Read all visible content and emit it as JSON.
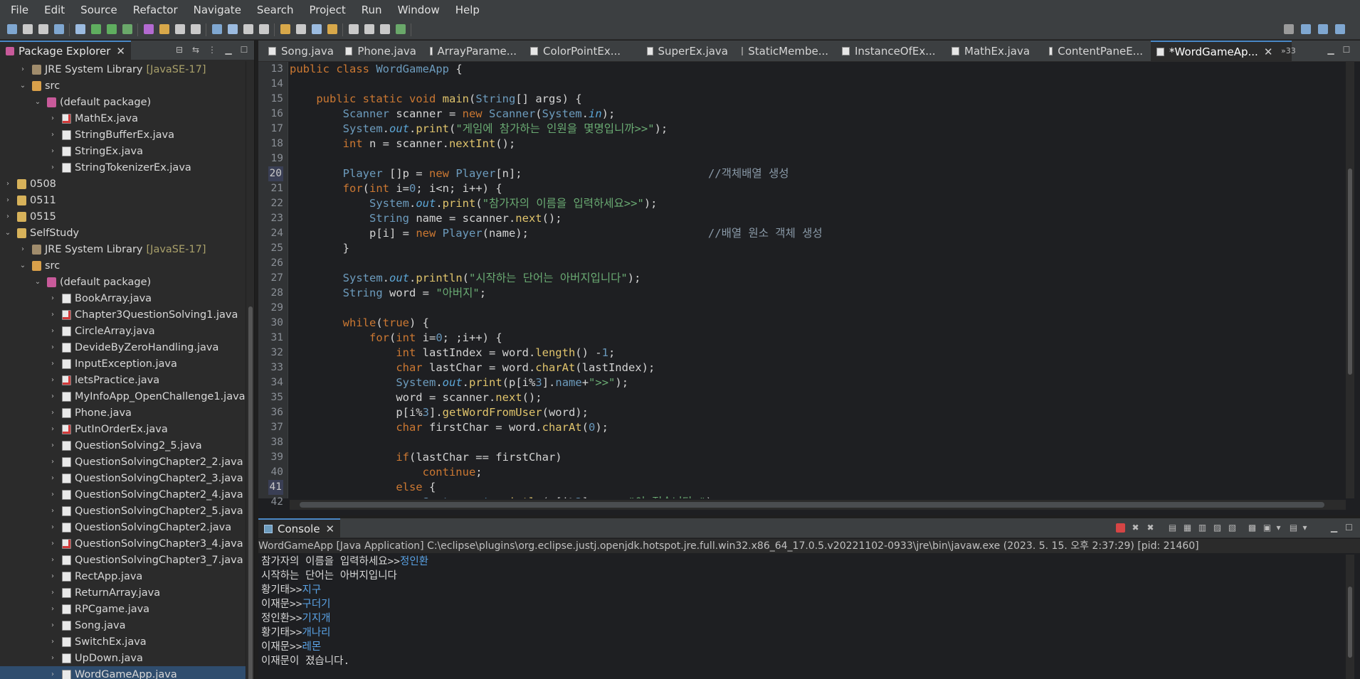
{
  "menu": [
    "File",
    "Edit",
    "Source",
    "Refactor",
    "Navigate",
    "Search",
    "Project",
    "Run",
    "Window",
    "Help"
  ],
  "package_explorer": {
    "title": "Package Explorer",
    "items": [
      {
        "label": "JRE System Library",
        "decoration": "[JavaSE-17]",
        "icon": "library-icon",
        "indent": 1,
        "arrow": "›"
      },
      {
        "label": "src",
        "icon": "source-folder-icon",
        "indent": 1,
        "arrow": "⌄"
      },
      {
        "label": "(default package)",
        "icon": "package-icon",
        "indent": 2,
        "arrow": "⌄"
      },
      {
        "label": "MathEx.java",
        "icon": "java-error-file-icon",
        "indent": 3,
        "arrow": "›"
      },
      {
        "label": "StringBufferEx.java",
        "icon": "java-file-icon",
        "indent": 3,
        "arrow": "›"
      },
      {
        "label": "StringEx.java",
        "icon": "java-file-icon",
        "indent": 3,
        "arrow": "›"
      },
      {
        "label": "StringTokenizerEx.java",
        "icon": "java-file-icon",
        "indent": 3,
        "arrow": "›"
      },
      {
        "label": "0508",
        "icon": "project-folder-icon",
        "indent": 0,
        "arrow": "›"
      },
      {
        "label": "0511",
        "icon": "project-folder-icon",
        "indent": 0,
        "arrow": "›"
      },
      {
        "label": "0515",
        "icon": "project-folder-icon",
        "indent": 0,
        "arrow": "›"
      },
      {
        "label": "SelfStudy",
        "icon": "project-folder-icon",
        "indent": 0,
        "arrow": "⌄"
      },
      {
        "label": "JRE System Library",
        "decoration": "[JavaSE-17]",
        "icon": "library-icon",
        "indent": 1,
        "arrow": "›"
      },
      {
        "label": "src",
        "icon": "source-folder-icon",
        "indent": 1,
        "arrow": "⌄"
      },
      {
        "label": "(default package)",
        "icon": "package-icon",
        "indent": 2,
        "arrow": "⌄"
      },
      {
        "label": "BookArray.java",
        "icon": "java-file-icon",
        "indent": 3,
        "arrow": "›"
      },
      {
        "label": "Chapter3QuestionSolving1.java",
        "icon": "java-error-file-icon",
        "indent": 3,
        "arrow": "›"
      },
      {
        "label": "CircleArray.java",
        "icon": "java-file-icon",
        "indent": 3,
        "arrow": "›"
      },
      {
        "label": "DevideByZeroHandling.java",
        "icon": "java-file-icon",
        "indent": 3,
        "arrow": "›"
      },
      {
        "label": "InputException.java",
        "icon": "java-file-icon",
        "indent": 3,
        "arrow": "›"
      },
      {
        "label": "letsPractice.java",
        "icon": "java-error-file-icon",
        "indent": 3,
        "arrow": "›"
      },
      {
        "label": "MyInfoApp_OpenChallenge1.java",
        "icon": "java-file-icon",
        "indent": 3,
        "arrow": "›"
      },
      {
        "label": "Phone.java",
        "icon": "java-file-icon",
        "indent": 3,
        "arrow": "›"
      },
      {
        "label": "PutInOrderEx.java",
        "icon": "java-error-file-icon",
        "indent": 3,
        "arrow": "›"
      },
      {
        "label": "QuestionSolving2_5.java",
        "icon": "java-file-icon",
        "indent": 3,
        "arrow": "›"
      },
      {
        "label": "QuestionSolvingChapter2_2.java",
        "icon": "java-file-icon",
        "indent": 3,
        "arrow": "›"
      },
      {
        "label": "QuestionSolvingChapter2_3.java",
        "icon": "java-file-icon",
        "indent": 3,
        "arrow": "›"
      },
      {
        "label": "QuestionSolvingChapter2_4.java",
        "icon": "java-file-icon",
        "indent": 3,
        "arrow": "›"
      },
      {
        "label": "QuestionSolvingChapter2_5.java",
        "icon": "java-file-icon",
        "indent": 3,
        "arrow": "›"
      },
      {
        "label": "QuestionSolvingChapter2.java",
        "icon": "java-file-icon",
        "indent": 3,
        "arrow": "›"
      },
      {
        "label": "QuestionSolvingChapter3_4.java",
        "icon": "java-error-file-icon",
        "indent": 3,
        "arrow": "›"
      },
      {
        "label": "QuestionSolvingChapter3_7.java",
        "icon": "java-file-icon",
        "indent": 3,
        "arrow": "›"
      },
      {
        "label": "RectApp.java",
        "icon": "java-file-icon",
        "indent": 3,
        "arrow": "›"
      },
      {
        "label": "ReturnArray.java",
        "icon": "java-file-icon",
        "indent": 3,
        "arrow": "›"
      },
      {
        "label": "RPCgame.java",
        "icon": "java-file-icon",
        "indent": 3,
        "arrow": "›"
      },
      {
        "label": "Song.java",
        "icon": "java-file-icon",
        "indent": 3,
        "arrow": "›"
      },
      {
        "label": "SwitchEx.java",
        "icon": "java-file-icon",
        "indent": 3,
        "arrow": "›"
      },
      {
        "label": "UpDown.java",
        "icon": "java-file-icon",
        "indent": 3,
        "arrow": "›"
      },
      {
        "label": "WordGameApp.java",
        "icon": "java-file-icon",
        "indent": 3,
        "arrow": "›",
        "selected": true
      }
    ]
  },
  "editor_tabs": [
    "Song.java",
    "Phone.java",
    "ArrayParame...",
    "ColorPointEx...",
    "SuperEx.java",
    "StaticMembe...",
    "InstanceOfEx...",
    "MathEx.java",
    "ContentPaneE...",
    "*WordGameAp..."
  ],
  "active_tab_index": 9,
  "tabs_overflow": "»33",
  "code": {
    "line_numbers": [
      "13",
      "14",
      "15",
      "16",
      "17",
      "18",
      "19",
      "20",
      "21",
      "22",
      "23",
      "24",
      "25",
      "26",
      "27",
      "28",
      "29",
      "30",
      "31",
      "32",
      "33",
      "34",
      "35",
      "36",
      "37",
      "38",
      "39",
      "40",
      "41",
      "42"
    ],
    "highlighted_lines": [
      "20",
      "41"
    ],
    "lines": [
      [
        [
          "kw",
          "public "
        ],
        [
          "kw",
          "class "
        ],
        [
          "ty",
          "WordGameApp"
        ],
        [
          "vr",
          " {"
        ]
      ],
      [],
      [
        [
          "vr",
          "    "
        ],
        [
          "kw",
          "public "
        ],
        [
          "kw",
          "static "
        ],
        [
          "kw",
          "void "
        ],
        [
          "fn",
          "main"
        ],
        [
          "vr",
          "("
        ],
        [
          "ty",
          "String"
        ],
        [
          "vr",
          "[] "
        ],
        [
          "vr",
          "args) {"
        ]
      ],
      [
        [
          "vr",
          "        "
        ],
        [
          "ty",
          "Scanner "
        ],
        [
          "vr",
          "scanner = "
        ],
        [
          "kw",
          "new "
        ],
        [
          "ty",
          "Scanner"
        ],
        [
          "vr",
          "("
        ],
        [
          "ty",
          "System"
        ],
        [
          "vr",
          "."
        ],
        [
          "fd",
          "in"
        ],
        [
          "vr",
          ");"
        ]
      ],
      [
        [
          "vr",
          "        "
        ],
        [
          "ty",
          "System"
        ],
        [
          "vr",
          "."
        ],
        [
          "fd",
          "out"
        ],
        [
          "vr",
          "."
        ],
        [
          "fn",
          "print"
        ],
        [
          "vr",
          "("
        ],
        [
          "st",
          "\"게임에 참가하는 인원을 몇명입니까>>\""
        ],
        [
          "vr",
          ");"
        ]
      ],
      [
        [
          "vr",
          "        "
        ],
        [
          "kw",
          "int "
        ],
        [
          "vr",
          "n = scanner."
        ],
        [
          "fn",
          "nextInt"
        ],
        [
          "vr",
          "();"
        ]
      ],
      [],
      [
        [
          "vr",
          "        "
        ],
        [
          "ty",
          "Player "
        ],
        [
          "vr",
          "[]p = "
        ],
        [
          "kw",
          "new "
        ],
        [
          "ty",
          "Player"
        ],
        [
          "vr",
          "[n];                            "
        ],
        [
          "cm",
          "//객체배열 생성"
        ]
      ],
      [
        [
          "vr",
          "        "
        ],
        [
          "kw",
          "for"
        ],
        [
          "vr",
          "("
        ],
        [
          "kw",
          "int "
        ],
        [
          "vr",
          "i="
        ],
        [
          "nm",
          "0"
        ],
        [
          "vr",
          "; i<n; i++) {"
        ]
      ],
      [
        [
          "vr",
          "            "
        ],
        [
          "ty",
          "System"
        ],
        [
          "vr",
          "."
        ],
        [
          "fd",
          "out"
        ],
        [
          "vr",
          "."
        ],
        [
          "fn",
          "print"
        ],
        [
          "vr",
          "("
        ],
        [
          "st",
          "\"참가자의 이름을 입력하세요>>\""
        ],
        [
          "vr",
          ");"
        ]
      ],
      [
        [
          "vr",
          "            "
        ],
        [
          "ty",
          "String "
        ],
        [
          "vr",
          "name = scanner."
        ],
        [
          "fn",
          "next"
        ],
        [
          "vr",
          "();"
        ]
      ],
      [
        [
          "vr",
          "            "
        ],
        [
          "vr",
          "p[i] = "
        ],
        [
          "kw",
          "new "
        ],
        [
          "ty",
          "Player"
        ],
        [
          "vr",
          "(name);                           "
        ],
        [
          "cm",
          "//배열 원소 객체 생성"
        ]
      ],
      [
        [
          "vr",
          "        }"
        ]
      ],
      [],
      [
        [
          "vr",
          "        "
        ],
        [
          "ty",
          "System"
        ],
        [
          "vr",
          "."
        ],
        [
          "fd",
          "out"
        ],
        [
          "vr",
          "."
        ],
        [
          "fn",
          "println"
        ],
        [
          "vr",
          "("
        ],
        [
          "st",
          "\"시작하는 단어는 아버지입니다\""
        ],
        [
          "vr",
          ");"
        ]
      ],
      [
        [
          "vr",
          "        "
        ],
        [
          "ty",
          "String "
        ],
        [
          "vr",
          "word = "
        ],
        [
          "st",
          "\"아버지\""
        ],
        [
          "vr",
          ";"
        ]
      ],
      [],
      [
        [
          "vr",
          "        "
        ],
        [
          "kw",
          "while"
        ],
        [
          "vr",
          "("
        ],
        [
          "kw",
          "true"
        ],
        [
          "vr",
          ") {"
        ]
      ],
      [
        [
          "vr",
          "            "
        ],
        [
          "kw",
          "for"
        ],
        [
          "vr",
          "("
        ],
        [
          "kw",
          "int "
        ],
        [
          "vr",
          "i="
        ],
        [
          "nm",
          "0"
        ],
        [
          "vr",
          "; ;i++) {"
        ]
      ],
      [
        [
          "vr",
          "                "
        ],
        [
          "kw",
          "int "
        ],
        [
          "vr",
          "lastIndex = word."
        ],
        [
          "fn",
          "length"
        ],
        [
          "vr",
          "() -"
        ],
        [
          "nm",
          "1"
        ],
        [
          "vr",
          ";"
        ]
      ],
      [
        [
          "vr",
          "                "
        ],
        [
          "kw",
          "char "
        ],
        [
          "vr",
          "lastChar = word."
        ],
        [
          "fn",
          "charAt"
        ],
        [
          "vr",
          "(lastIndex);"
        ]
      ],
      [
        [
          "vr",
          "                "
        ],
        [
          "ty",
          "System"
        ],
        [
          "vr",
          "."
        ],
        [
          "fd",
          "out"
        ],
        [
          "vr",
          "."
        ],
        [
          "fn",
          "print"
        ],
        [
          "vr",
          "(p[i%"
        ],
        [
          "nm",
          "3"
        ],
        [
          "vr",
          "]."
        ],
        [
          "ty",
          "name"
        ],
        [
          "vr",
          "+"
        ],
        [
          "st",
          "\">>\""
        ],
        [
          "vr",
          ");"
        ]
      ],
      [
        [
          "vr",
          "                "
        ],
        [
          "vr",
          "word = scanner."
        ],
        [
          "fn",
          "next"
        ],
        [
          "vr",
          "();"
        ]
      ],
      [
        [
          "vr",
          "                "
        ],
        [
          "vr",
          "p[i%"
        ],
        [
          "nm",
          "3"
        ],
        [
          "vr",
          "]."
        ],
        [
          "fn",
          "getWordFromUser"
        ],
        [
          "vr",
          "(word);"
        ]
      ],
      [
        [
          "vr",
          "                "
        ],
        [
          "kw",
          "char "
        ],
        [
          "vr",
          "firstChar = word."
        ],
        [
          "fn",
          "charAt"
        ],
        [
          "vr",
          "("
        ],
        [
          "nm",
          "0"
        ],
        [
          "vr",
          ");"
        ]
      ],
      [],
      [
        [
          "vr",
          "                "
        ],
        [
          "kw",
          "if"
        ],
        [
          "vr",
          "(lastChar == firstChar)"
        ]
      ],
      [
        [
          "vr",
          "                    "
        ],
        [
          "kw",
          "continue"
        ],
        [
          "vr",
          ";"
        ]
      ],
      [
        [
          "vr",
          "                "
        ],
        [
          "kw",
          "else "
        ],
        [
          "vr",
          "{"
        ]
      ],
      [
        [
          "vr",
          "                    "
        ],
        [
          "ty",
          "System"
        ],
        [
          "vr",
          "."
        ],
        [
          "fd",
          "out"
        ],
        [
          "vr",
          "."
        ],
        [
          "fn",
          "println"
        ],
        [
          "vr",
          "(p[i%"
        ],
        [
          "nm",
          "3"
        ],
        [
          "vr",
          "]."
        ],
        [
          "ty",
          "name"
        ],
        [
          "vr",
          "+"
        ],
        [
          "st",
          "\"이 졌습니다.\""
        ],
        [
          "vr",
          ");"
        ]
      ]
    ]
  },
  "console": {
    "title": "Console",
    "path": "WordGameApp [Java Application] C:\\eclipse\\plugins\\org.eclipse.justj.openjdk.hotspot.jre.full.win32.x86_64_17.0.5.v20221102-0933\\jre\\bin\\javaw.exe  (2023. 5. 15. 오후 2:37:29) [pid: 21460]",
    "lines": [
      {
        "prompt": "참가자의 이름을 입력하세요>>",
        "input": "정인환"
      },
      {
        "prompt": "시작하는 단어는 아버지입니다",
        "input": ""
      },
      {
        "prompt": "황기태>>",
        "input": "지구"
      },
      {
        "prompt": "이재문>>",
        "input": "구더기"
      },
      {
        "prompt": "정인환>>",
        "input": "기지개"
      },
      {
        "prompt": "황기태>>",
        "input": "개나리"
      },
      {
        "prompt": "이재문>>",
        "input": "레몬"
      },
      {
        "prompt": "이재문이 졌습니다.",
        "input": ""
      }
    ]
  }
}
